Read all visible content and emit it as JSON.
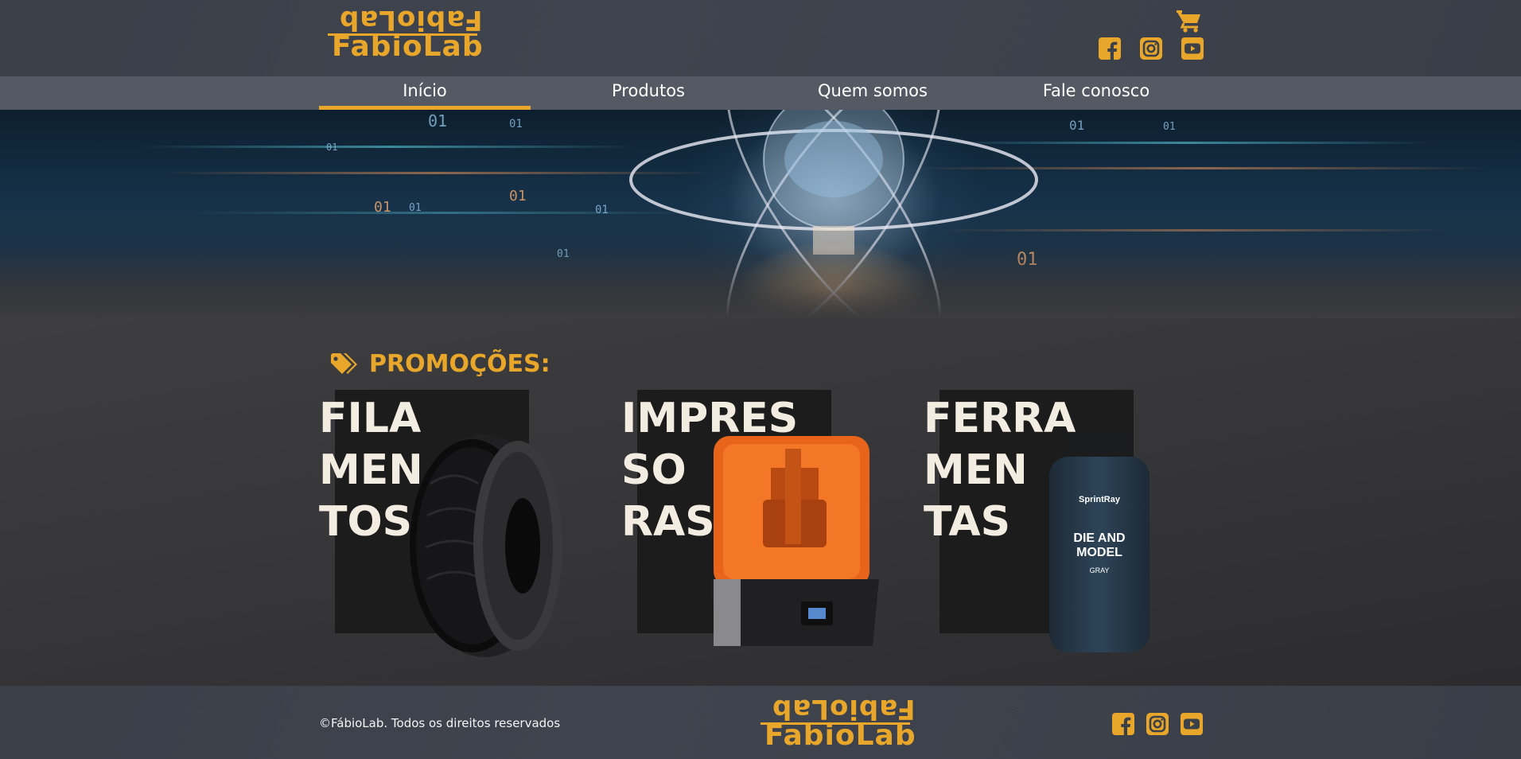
{
  "brand": {
    "logo_mirror": "FabioLab",
    "logo_text": "FabioLab",
    "accent_color": "#e8a72a"
  },
  "header": {
    "cart_icon": "shopping-cart-icon",
    "social": [
      "facebook-icon",
      "instagram-icon",
      "youtube-icon"
    ]
  },
  "nav": {
    "items": [
      {
        "label": "Início",
        "active": true
      },
      {
        "label": "Produtos",
        "active": false
      },
      {
        "label": "Quem somos",
        "active": false
      },
      {
        "label": "Fale conosco",
        "active": false
      }
    ]
  },
  "hero": {
    "binary": [
      "01",
      "01",
      "01",
      "01",
      "01",
      "01",
      "01",
      "01",
      "01",
      "01",
      "01"
    ]
  },
  "promo": {
    "title": "PROMOÇÕES:",
    "icon": "tags-icon",
    "cards": [
      {
        "title": "FILA\nMEN\nTOS",
        "image": "filament-spool"
      },
      {
        "title": "IMPRES\nSO\nRAS",
        "image": "3d-printer"
      },
      {
        "title": "FERRA\nMEN\nTAS",
        "image": "resin-bottle",
        "bottle_brand": "SprintRay",
        "bottle_label_1": "DIE AND",
        "bottle_label_2": "MODEL",
        "bottle_label_3": "GRAY"
      }
    ]
  },
  "footer": {
    "copyright": "©FábioLab. Todos os direitos reservados",
    "social": [
      "facebook-icon",
      "instagram-icon",
      "youtube-icon"
    ]
  }
}
